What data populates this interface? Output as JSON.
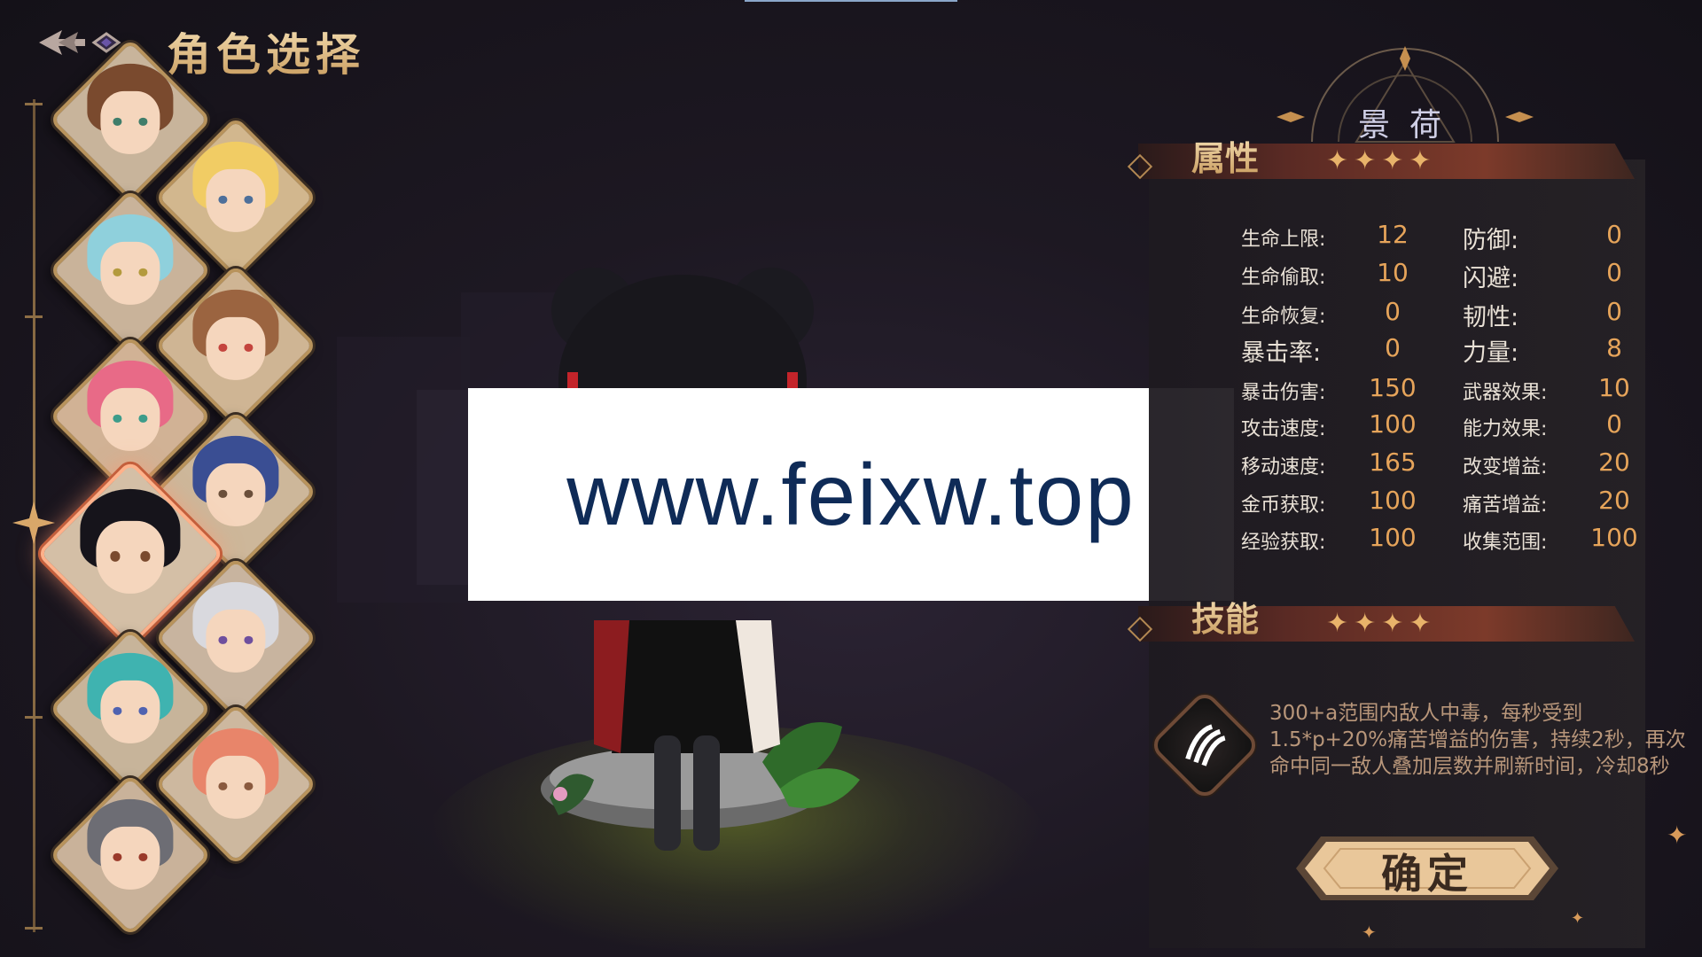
{
  "header": {
    "title": "角色选择"
  },
  "character": {
    "name": "景荷"
  },
  "sections": {
    "attributes": "属性",
    "skills": "技能"
  },
  "stats_left": [
    {
      "label": "生命上限:",
      "value": "12"
    },
    {
      "label": "生命偷取:",
      "value": "10"
    },
    {
      "label": "生命恢复:",
      "value": "0"
    },
    {
      "label": "暴击率:",
      "value": "0"
    },
    {
      "label": "暴击伤害:",
      "value": "150"
    },
    {
      "label": "攻击速度:",
      "value": "100"
    },
    {
      "label": "移动速度:",
      "value": "165"
    },
    {
      "label": "金币获取:",
      "value": "100"
    },
    {
      "label": "经验获取:",
      "value": "100"
    }
  ],
  "stats_right": [
    {
      "label": "防御:",
      "value": "0"
    },
    {
      "label": "闪避:",
      "value": "0"
    },
    {
      "label": "韧性:",
      "value": "0"
    },
    {
      "label": "力量:",
      "value": "8"
    },
    {
      "label": "武器效果:",
      "value": "10"
    },
    {
      "label": "能力效果:",
      "value": "0"
    },
    {
      "label": "改变增益:",
      "value": "20"
    },
    {
      "label": "痛苦增益:",
      "value": "20"
    },
    {
      "label": "收集范围:",
      "value": "100"
    }
  ],
  "skill": {
    "description": "300+a范围内敌人中毒，每秒受到1.5*p+20%痛苦增益的伤害，持续2秒，再次命中同一敌人叠加层数并刷新时间，冷却8秒"
  },
  "confirm_label": "确定",
  "watermark": "www.feixw.top",
  "colors": {
    "accent_gold": "#c7995a",
    "value_orange": "#e6a45a",
    "selected_glow": "#ffb18a"
  }
}
